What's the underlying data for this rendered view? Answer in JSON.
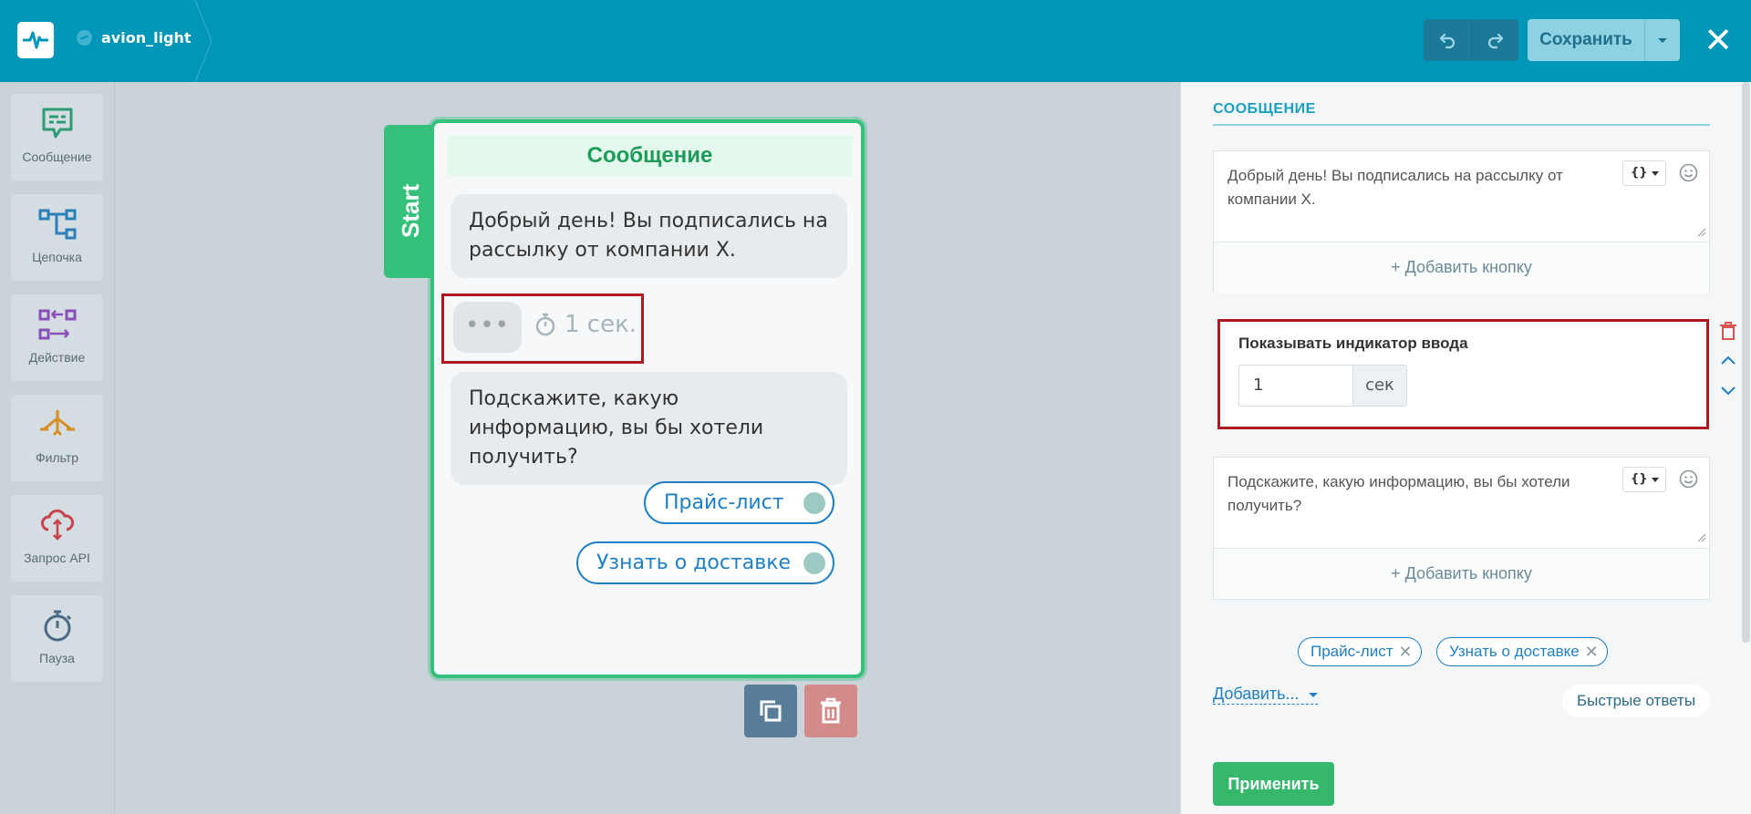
{
  "header": {
    "bot_name": "avion_light",
    "save_label": "Сохранить"
  },
  "toolbox": {
    "items": [
      {
        "label": "Сообщение",
        "icon": "message-icon"
      },
      {
        "label": "Цепочка",
        "icon": "chain-icon"
      },
      {
        "label": "Действие",
        "icon": "action-icon"
      },
      {
        "label": "Фильтр",
        "icon": "filter-icon"
      },
      {
        "label": "Запрос API",
        "icon": "api-request-icon"
      },
      {
        "label": "Пауза",
        "icon": "pause-timer-icon"
      }
    ]
  },
  "canvas": {
    "start_label": "Start",
    "node": {
      "title": "Сообщение",
      "message1": "Добрый день! Вы подписались на рассылку от компании X.",
      "typing_dots": "•••",
      "typing_time": "1 сек.",
      "message2": "Подскажите, какую информацию, вы бы хотели получить?",
      "buttons": [
        "Прайс-лист",
        "Узнать о доставке"
      ]
    }
  },
  "panel": {
    "heading": "СООБЩЕНИЕ",
    "message1": "Добрый день! Вы подписались на рассылку от компании X.",
    "var_label": "{}",
    "add_button_label": "+ Добавить кнопку",
    "typing_label": "Показывать индикатор ввода",
    "typing_value": "1",
    "typing_unit": "сек",
    "message2": "Подскажите, какую информацию, вы бы хотели получить?",
    "chips": [
      "Прайс-лист",
      "Узнать о доставке"
    ],
    "chip_remove": "✕",
    "add_dropdown": "Добавить...",
    "quick_replies": "Быстрые ответы",
    "apply": "Применить"
  },
  "colors": {
    "header": "#0096b8",
    "accent_green": "#35c17a",
    "highlight_red": "#b01820",
    "link_blue": "#1e7fc6"
  }
}
